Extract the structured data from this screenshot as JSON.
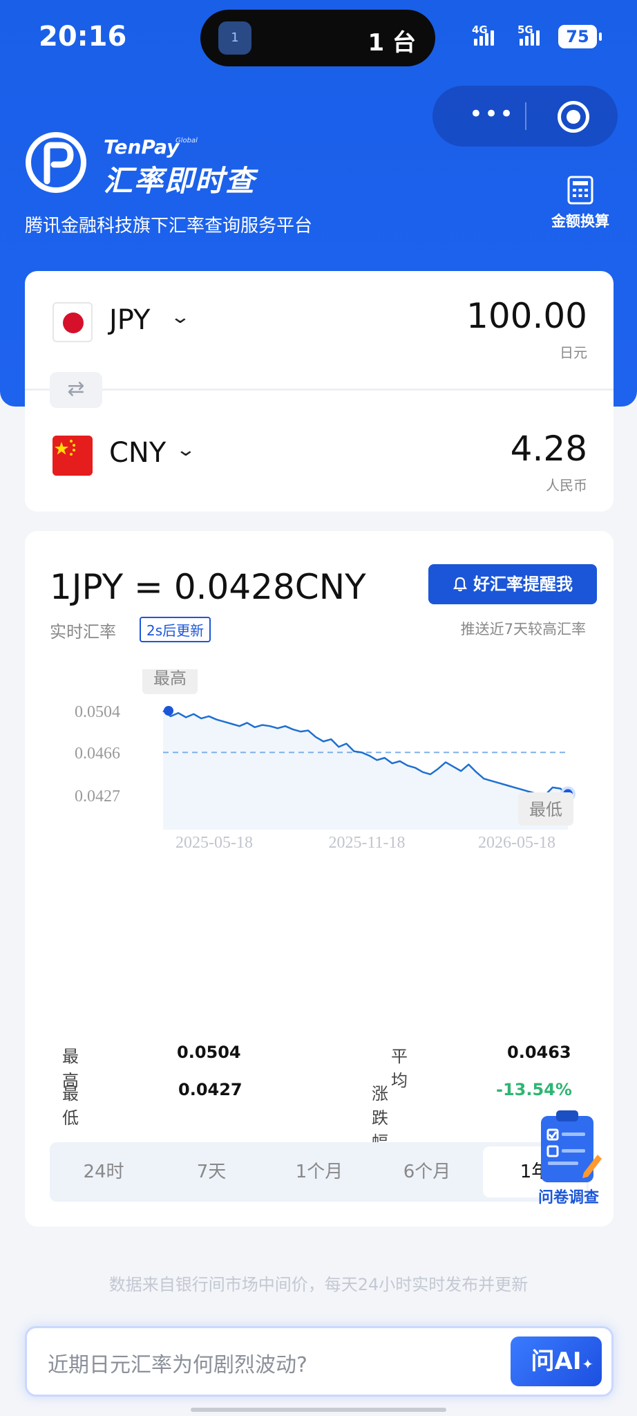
{
  "status_bar": {
    "time": "20:16",
    "island_icon_badge": "1",
    "island_text": "1 台",
    "signal_1": "4G",
    "signal_2": "5G",
    "battery": "75"
  },
  "capsule": {
    "more_label": "•••"
  },
  "header": {
    "brand_small": "TenPay",
    "brand_global": "Global",
    "brand_title": "汇率即时查",
    "subtitle": "腾讯金融科技旗下汇率查询服务平台",
    "calc_label": "金额换算"
  },
  "converter": {
    "from": {
      "code": "JPY",
      "amount": "100.00",
      "unit": "日元"
    },
    "to": {
      "code": "CNY",
      "amount": "4.28",
      "unit": "人民币"
    },
    "swap_icon": "⇄"
  },
  "rate": {
    "main": "1JPY = 0.0428CNY",
    "sub_label": "实时汇率",
    "refresh_badge": "2s后更新",
    "remind_button": "好汇率提醒我",
    "push_text": "推送近7天较高汇率"
  },
  "chart_data": {
    "type": "line",
    "yticks": [
      "0.0504",
      "0.0466",
      "0.0427"
    ],
    "xticks": [
      "2025-05-18",
      "2025-11-18",
      "2026-05-18"
    ],
    "max_tag": "最高",
    "min_tag": "最低",
    "ylim": [
      0.0427,
      0.0504
    ],
    "average_line": 0.0466,
    "series": [
      {
        "values": [
          0.0504,
          0.0499,
          0.0502,
          0.0498,
          0.0501,
          0.0497,
          0.0499,
          0.0496,
          0.0494,
          0.0492,
          0.049,
          0.0493,
          0.0489,
          0.0491,
          0.049,
          0.0488,
          0.049,
          0.0487,
          0.0485,
          0.0486,
          0.048,
          0.0476,
          0.0478,
          0.0471,
          0.0474,
          0.0467,
          0.0466,
          0.0463,
          0.0459,
          0.0461,
          0.0456,
          0.0458,
          0.0454,
          0.0452,
          0.0448,
          0.0446,
          0.0451,
          0.0457,
          0.0453,
          0.0449,
          0.0455,
          0.0448,
          0.0442,
          0.044,
          0.0438,
          0.0436,
          0.0434,
          0.0432,
          0.043,
          0.0428,
          0.0427,
          0.0434,
          0.0433,
          0.0428
        ]
      }
    ]
  },
  "stats": {
    "high_label": "最高",
    "high_value": "0.0504",
    "low_label": "最低",
    "low_value": "0.0427",
    "avg_label": "平均",
    "avg_value": "0.0463",
    "change_label": "涨跌幅",
    "change_value": "-13.54%",
    "change_color": "#2fb573"
  },
  "tabs": [
    "24时",
    "7天",
    "1个月",
    "6个月",
    "1年"
  ],
  "active_tab": "1年",
  "survey_label": "问卷调查",
  "footer_note": "数据来自银行间市场中间价，每天24小时实时发布并更新",
  "ask": {
    "placeholder": "近期日元汇率为何剧烈波动?",
    "button": "问AI",
    "spark": "✦"
  },
  "colors": {
    "brand_blue": "#1a5fe8",
    "line": "#1f6fd0",
    "avg_dash": "#7fb0e8",
    "positive_green": "#2fb573"
  }
}
